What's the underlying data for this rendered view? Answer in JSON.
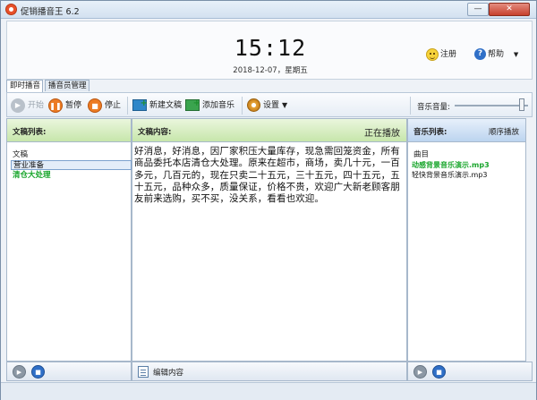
{
  "window": {
    "title": "促销播音王 6.2",
    "min_label": "—",
    "close_label": "✕"
  },
  "header": {
    "time": "15:12",
    "date": "2018-12-07，星期五",
    "register_label": "注册",
    "help_label": "帮助",
    "help_arrow": "▼"
  },
  "tabs": [
    {
      "label": "即时播音"
    },
    {
      "label": "播音员管理"
    }
  ],
  "toolbar": {
    "start_label": "开始",
    "pause_label": "暂停",
    "stop_label": "停止",
    "new_doc_label": "新建文稿",
    "add_music_label": "添加音乐",
    "settings_label": "设置",
    "settings_arrow": "▼",
    "volume_label": "音乐音量:",
    "music_volume": 0.95
  },
  "doc_list": {
    "title": "文稿列表:",
    "column": "文稿",
    "items": [
      {
        "label": "营业准备"
      },
      {
        "label": "清仓大处理"
      }
    ]
  },
  "doc_content": {
    "title": "文稿内容:",
    "status": "正在播放",
    "text": "好消息，好消息，因厂家积压大量库存，现急需回笼资金，所有商品委托本店清仓大处理。原来在超市，商场，卖几十元，一百多元，几百元的，现在只卖二十五元，三十五元，四十五元，五十五元，品种众多，质量保证，价格不贵，欢迎广大新老顾客朋友前来选购，买不买，没关系，看看也欢迎。"
  },
  "music_list": {
    "title": "音乐列表:",
    "mode": "顺序播放",
    "column": "曲目",
    "items": [
      {
        "label": "动感背景音乐演示.mp3"
      },
      {
        "label": "轻快背景音乐演示.mp3"
      }
    ]
  },
  "bottom": {
    "edit_label": "编辑内容"
  },
  "colors": {
    "playing_green": "#18a52b",
    "accent_orange": "#ec7b23",
    "accent_blue": "#2f6fc7"
  },
  "icons": [
    "app-icon",
    "smile-icon",
    "help-icon",
    "play-icon",
    "pause-icon",
    "stop-icon",
    "new-doc-icon",
    "add-music-icon",
    "gear-icon",
    "edit-icon"
  ]
}
